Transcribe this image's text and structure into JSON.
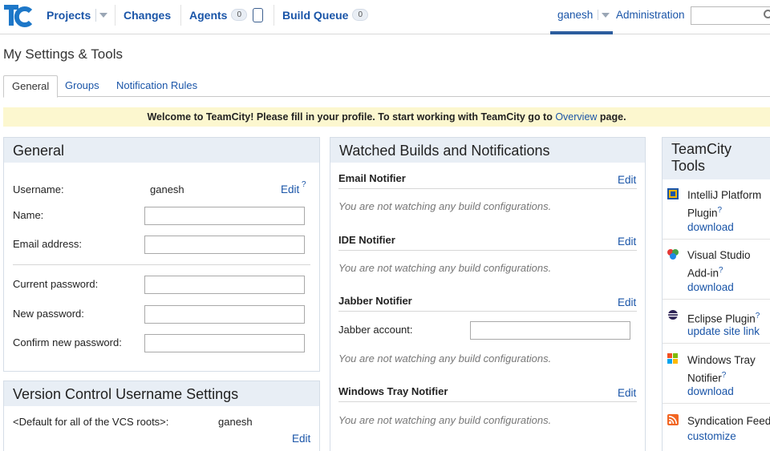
{
  "nav": {
    "projects": "Projects",
    "changes": "Changes",
    "agents": "Agents",
    "agents_count": "0",
    "build_queue": "Build Queue",
    "build_queue_count": "0",
    "user": "ganesh",
    "administration": "Administration"
  },
  "page_title": "My Settings & Tools",
  "tabs": [
    "General",
    "Groups",
    "Notification Rules"
  ],
  "banner": {
    "text_before": "Welcome to TeamCity! Please fill in your profile. To start working with TeamCity go to ",
    "link": "Overview",
    "text_after": " page."
  },
  "general": {
    "title": "General",
    "username_label": "Username:",
    "username_value": "ganesh",
    "edit": "Edit",
    "name_label": "Name:",
    "email_label": "Email address:",
    "current_password_label": "Current password:",
    "new_password_label": "New password:",
    "confirm_password_label": "Confirm new password:"
  },
  "vcs": {
    "title": "Version Control Username Settings",
    "default_label": "<Default for all of the VCS roots>:",
    "default_value": "ganesh",
    "edit": "Edit"
  },
  "watched": {
    "title": "Watched Builds and Notifications",
    "edit": "Edit",
    "empty_text": "You are not watching any build configurations.",
    "email_notifier": "Email Notifier",
    "ide_notifier": "IDE Notifier",
    "jabber_notifier": "Jabber Notifier",
    "jabber_account_label": "Jabber account:",
    "windows_tray_notifier": "Windows Tray Notifier"
  },
  "tools": {
    "title": "TeamCity Tools",
    "items": [
      {
        "name": "IntelliJ Platform Plugin",
        "link": "download",
        "icon": "intellij-icon"
      },
      {
        "name": "Visual Studio Add-in",
        "link": "download",
        "icon": "visual-studio-icon"
      },
      {
        "name": "Eclipse Plugin",
        "link": "update site link",
        "icon": "eclipse-icon"
      },
      {
        "name": "Windows Tray Notifier",
        "link": "download",
        "icon": "windows-icon"
      },
      {
        "name": "Syndication Feed",
        "link": "customize",
        "icon": "rss-icon"
      }
    ]
  },
  "help_glyph": "?"
}
